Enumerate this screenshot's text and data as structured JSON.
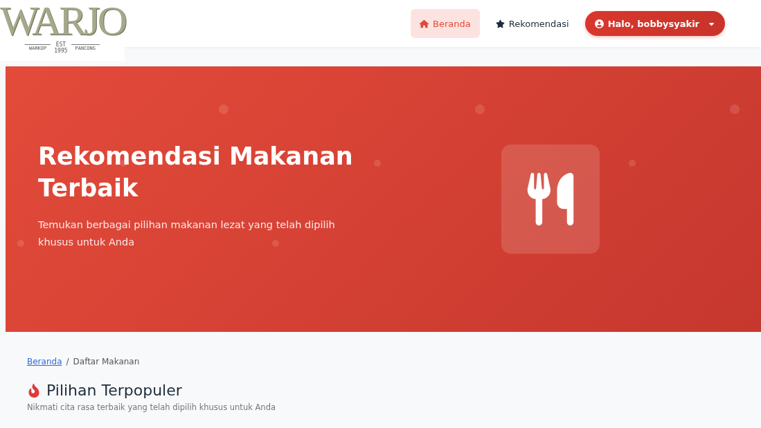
{
  "logo": {
    "name": "WARJO",
    "left": "WARKOP",
    "est": "EST",
    "year": "1995",
    "right": "PANCONG"
  },
  "nav": {
    "items": [
      {
        "label": "Beranda",
        "kind": "home",
        "selected": true
      },
      {
        "label": "Rekomendasi",
        "kind": "featured",
        "selected": false
      }
    ],
    "user_menu": {
      "label": "Halo, bobbysyakir"
    }
  },
  "hero": {
    "title": "Rekomendasi Makanan Terbaik",
    "subtitle": "Temukan berbagai pilihan makanan lezat yang telah dipilih khusus untuk Anda"
  },
  "breadcrumb": {
    "link": "Beranda",
    "separator": "/",
    "current": "Daftar Makanan"
  },
  "section": {
    "title": "Pilihan Terpopuler",
    "subtitle": "Nikmati cita rasa terbaik yang telah dipilih khusus untuk Anda"
  }
}
